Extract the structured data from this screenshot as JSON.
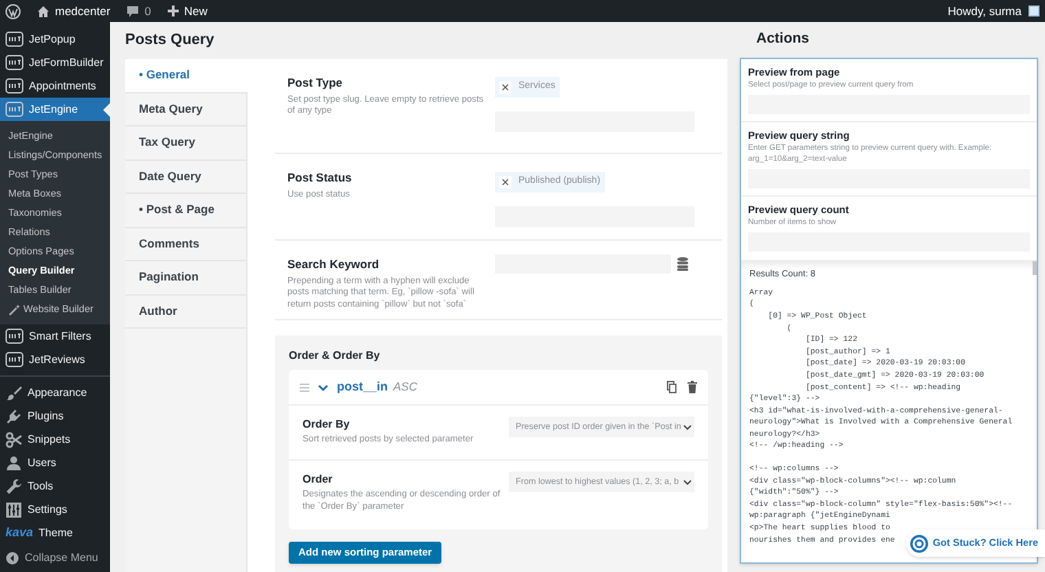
{
  "admin_bar": {
    "site": "medcenter",
    "comments": "0",
    "new": "New",
    "howdy": "Howdy, surma"
  },
  "sidebar": {
    "sections": [
      {
        "items": [
          {
            "label": "JetPopup",
            "kind": "plugin",
            "selected": false
          },
          {
            "label": "JetFormBuilder",
            "kind": "plugin",
            "selected": false
          },
          {
            "label": "Appointments",
            "kind": "plugin",
            "selected": false
          },
          {
            "label": "JetEngine",
            "kind": "plugin",
            "selected": true,
            "children": [
              {
                "label": "JetEngine",
                "selected": false
              },
              {
                "label": "Listings/Components",
                "selected": false
              },
              {
                "label": "Post Types",
                "selected": false
              },
              {
                "label": "Meta Boxes",
                "selected": false
              },
              {
                "label": "Taxonomies",
                "selected": false
              },
              {
                "label": "Relations",
                "selected": false
              },
              {
                "label": "Options Pages",
                "selected": false
              },
              {
                "label": "Query Builder",
                "selected": true
              },
              {
                "label": "Tables Builder",
                "selected": false
              },
              {
                "label": "Website Builder",
                "selected": false,
                "kind": "wand"
              }
            ]
          },
          {
            "label": "Smart Filters",
            "kind": "plugin",
            "selected": false
          },
          {
            "label": "JetReviews",
            "kind": "plugin",
            "selected": false
          }
        ]
      },
      {
        "items": [
          {
            "label": "Appearance",
            "kind": "brush",
            "selected": false
          },
          {
            "label": "Plugins",
            "kind": "plug",
            "selected": false
          },
          {
            "label": "Snippets",
            "kind": "scissors",
            "selected": false
          },
          {
            "label": "Users",
            "kind": "user",
            "selected": false
          },
          {
            "label": "Tools",
            "kind": "wrench",
            "selected": false
          },
          {
            "label": "Settings",
            "kind": "settings",
            "selected": false
          },
          {
            "label": "Theme",
            "kind": "logo",
            "logo_text": "kava",
            "selected": false
          }
        ]
      }
    ],
    "collapse": "Collapse Menu"
  },
  "page_title": "Posts Query",
  "tabs": [
    {
      "label": "• General",
      "selected": true
    },
    {
      "label": "Meta Query",
      "selected": false
    },
    {
      "label": "Tax Query",
      "selected": false
    },
    {
      "label": "Date Query",
      "selected": false
    },
    {
      "label": "• Post & Page",
      "selected": false
    },
    {
      "label": "Comments",
      "selected": false
    },
    {
      "label": "Pagination",
      "selected": false
    },
    {
      "label": "Author",
      "selected": false
    }
  ],
  "fields": [
    {
      "kind": "tags",
      "label": "Post Type",
      "description": "Set post type slug. Leave empty to retrieve posts of any type",
      "tags": [
        "Services"
      ]
    },
    {
      "kind": "tags",
      "label": "Post Status",
      "description": "Use post status",
      "tags": [
        "Published (publish)"
      ]
    },
    {
      "kind": "search",
      "label": "Search Keyword",
      "description": "Prepending a term with a hyphen will exclude posts matching that term. Eg, `pillow -sofa` will return posts containing `pillow` but not `sofa`"
    }
  ],
  "order": {
    "title": "Order & Order By",
    "item": {
      "key": "post__in",
      "direction": "ASC",
      "expanded": true,
      "fields": [
        {
          "label": "Order By",
          "description": "Sort retrieved posts by selected parameter",
          "value": "Preserve post ID order given in the `Post in"
        },
        {
          "label": "Order",
          "description": "Designates the ascending or descending order of the `Order By` parameter",
          "value": "From lowest to highest values (1, 2, 3; a, b"
        }
      ]
    },
    "add_button": "Add new sorting parameter"
  },
  "actions": {
    "title": "Actions",
    "fields": [
      {
        "label": "Preview from page",
        "description": "Select post/page to preview current query from"
      },
      {
        "label": "Preview query string",
        "description": "Enter GET parameters string to preview current query with. Example: arg_1=10&arg_2=text-value"
      },
      {
        "label": "Preview query count",
        "description": "Number of items to show"
      }
    ],
    "results": "Results Count: 8",
    "code_blocks": [
      [
        "Array",
        "(",
        "    [0] => WP_Post Object",
        "        (",
        "            [ID] => 122",
        "            [post_author] => 1",
        "            [post_date] => 2020-03-19 20:03:00",
        "            [post_date_gmt] => 2020-03-19 20:03:00",
        "            [post_content] => <!-- wp:heading",
        "{\"level\":3} -->",
        "<h3 id=\"what-is-involved-with-a-comprehensive-general-",
        "neurology\">What is Involved with a Comprehensive General",
        "neurology?</h3>",
        "<!-- /wp:heading -->"
      ],
      [
        "<!-- wp:columns -->",
        "<div class=\"wp-block-columns\"><!-- wp:column",
        "{\"width\":\"50%\"} -->",
        "<div class=\"wp-block-column\" style=\"flex-basis:50%\"><!--",
        "wp:paragraph {\"jetEngineDynami",
        "<p>The heart supplies blood to",
        "nourishes them and provides ene"
      ]
    ]
  },
  "help_button": "Got Stuck? Click Here"
}
